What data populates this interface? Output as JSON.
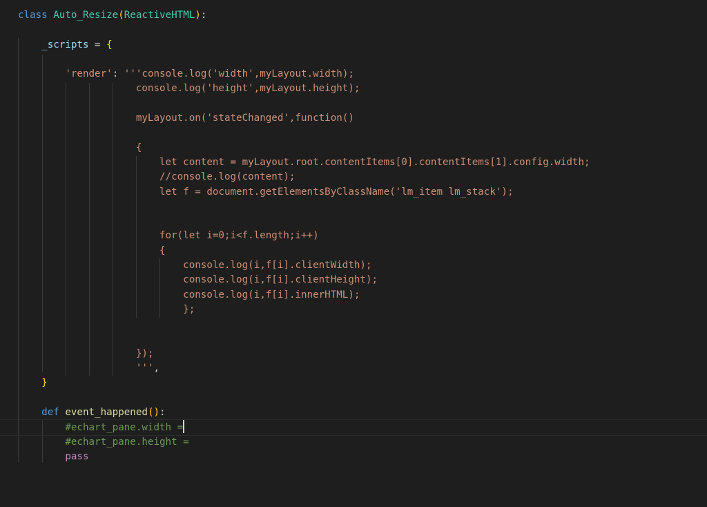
{
  "editor": {
    "lines": [
      [
        {
          "t": "class",
          "c": "keyword"
        },
        {
          "t": " ",
          "c": "plain"
        },
        {
          "t": "Auto_Resize",
          "c": "class"
        },
        {
          "t": "(",
          "c": "paren"
        },
        {
          "t": "ReactiveHTML",
          "c": "class"
        },
        {
          "t": ")",
          "c": "paren"
        },
        {
          "t": ":",
          "c": "plain"
        }
      ],
      [],
      [
        {
          "t": "    ",
          "c": "plain"
        },
        {
          "t": "_scripts",
          "c": "var"
        },
        {
          "t": " = ",
          "c": "plain"
        },
        {
          "t": "{",
          "c": "paren"
        }
      ],
      [],
      [
        {
          "t": "        ",
          "c": "plain"
        },
        {
          "t": "'render'",
          "c": "string"
        },
        {
          "t": ": ",
          "c": "plain"
        },
        {
          "t": "'''console.log('width',myLayout.width);",
          "c": "string"
        }
      ],
      [
        {
          "t": "                    console.log('height',myLayout.height);",
          "c": "string"
        }
      ],
      [],
      [
        {
          "t": "                    myLayout.on('stateChanged',function()",
          "c": "string"
        }
      ],
      [],
      [
        {
          "t": "                    {",
          "c": "string"
        }
      ],
      [
        {
          "t": "                        let content = myLayout.root.contentItems[0].contentItems[1].config.width;",
          "c": "string"
        }
      ],
      [
        {
          "t": "                        //console.log(content);",
          "c": "string"
        }
      ],
      [
        {
          "t": "                        let f = document.getElementsByClassName('lm_item lm_stack');",
          "c": "string"
        }
      ],
      [],
      [],
      [
        {
          "t": "                        for(let i=0;i<f.length;i++)",
          "c": "string"
        }
      ],
      [
        {
          "t": "                        {",
          "c": "string"
        }
      ],
      [
        {
          "t": "                            console.log(i,f[i].clientWidth);",
          "c": "string"
        }
      ],
      [
        {
          "t": "                            console.log(i,f[i].clientHeight);",
          "c": "string"
        }
      ],
      [
        {
          "t": "                            console.log(i,f[i].innerHTML);",
          "c": "string"
        }
      ],
      [
        {
          "t": "                            };",
          "c": "string"
        }
      ],
      [],
      [],
      [
        {
          "t": "                    });",
          "c": "string"
        }
      ],
      [
        {
          "t": "                    '''",
          "c": "string"
        },
        {
          "t": ",",
          "c": "plain"
        }
      ],
      [
        {
          "t": "    ",
          "c": "plain"
        },
        {
          "t": "}",
          "c": "paren"
        }
      ],
      [],
      [
        {
          "t": "    ",
          "c": "plain"
        },
        {
          "t": "def",
          "c": "keyword"
        },
        {
          "t": " ",
          "c": "plain"
        },
        {
          "t": "event_happened",
          "c": "func"
        },
        {
          "t": "()",
          "c": "paren"
        },
        {
          "t": ":",
          "c": "plain"
        }
      ],
      [
        {
          "t": "        ",
          "c": "plain"
        },
        {
          "t": "#echart_pane.width =",
          "c": "comment"
        }
      ],
      [
        {
          "t": "        ",
          "c": "plain"
        },
        {
          "t": "#echart_pane.height =",
          "c": "comment"
        }
      ],
      [
        {
          "t": "        ",
          "c": "plain"
        },
        {
          "t": "pass",
          "c": "control"
        }
      ]
    ],
    "current_line": 28,
    "cursor_after_line": 28
  }
}
